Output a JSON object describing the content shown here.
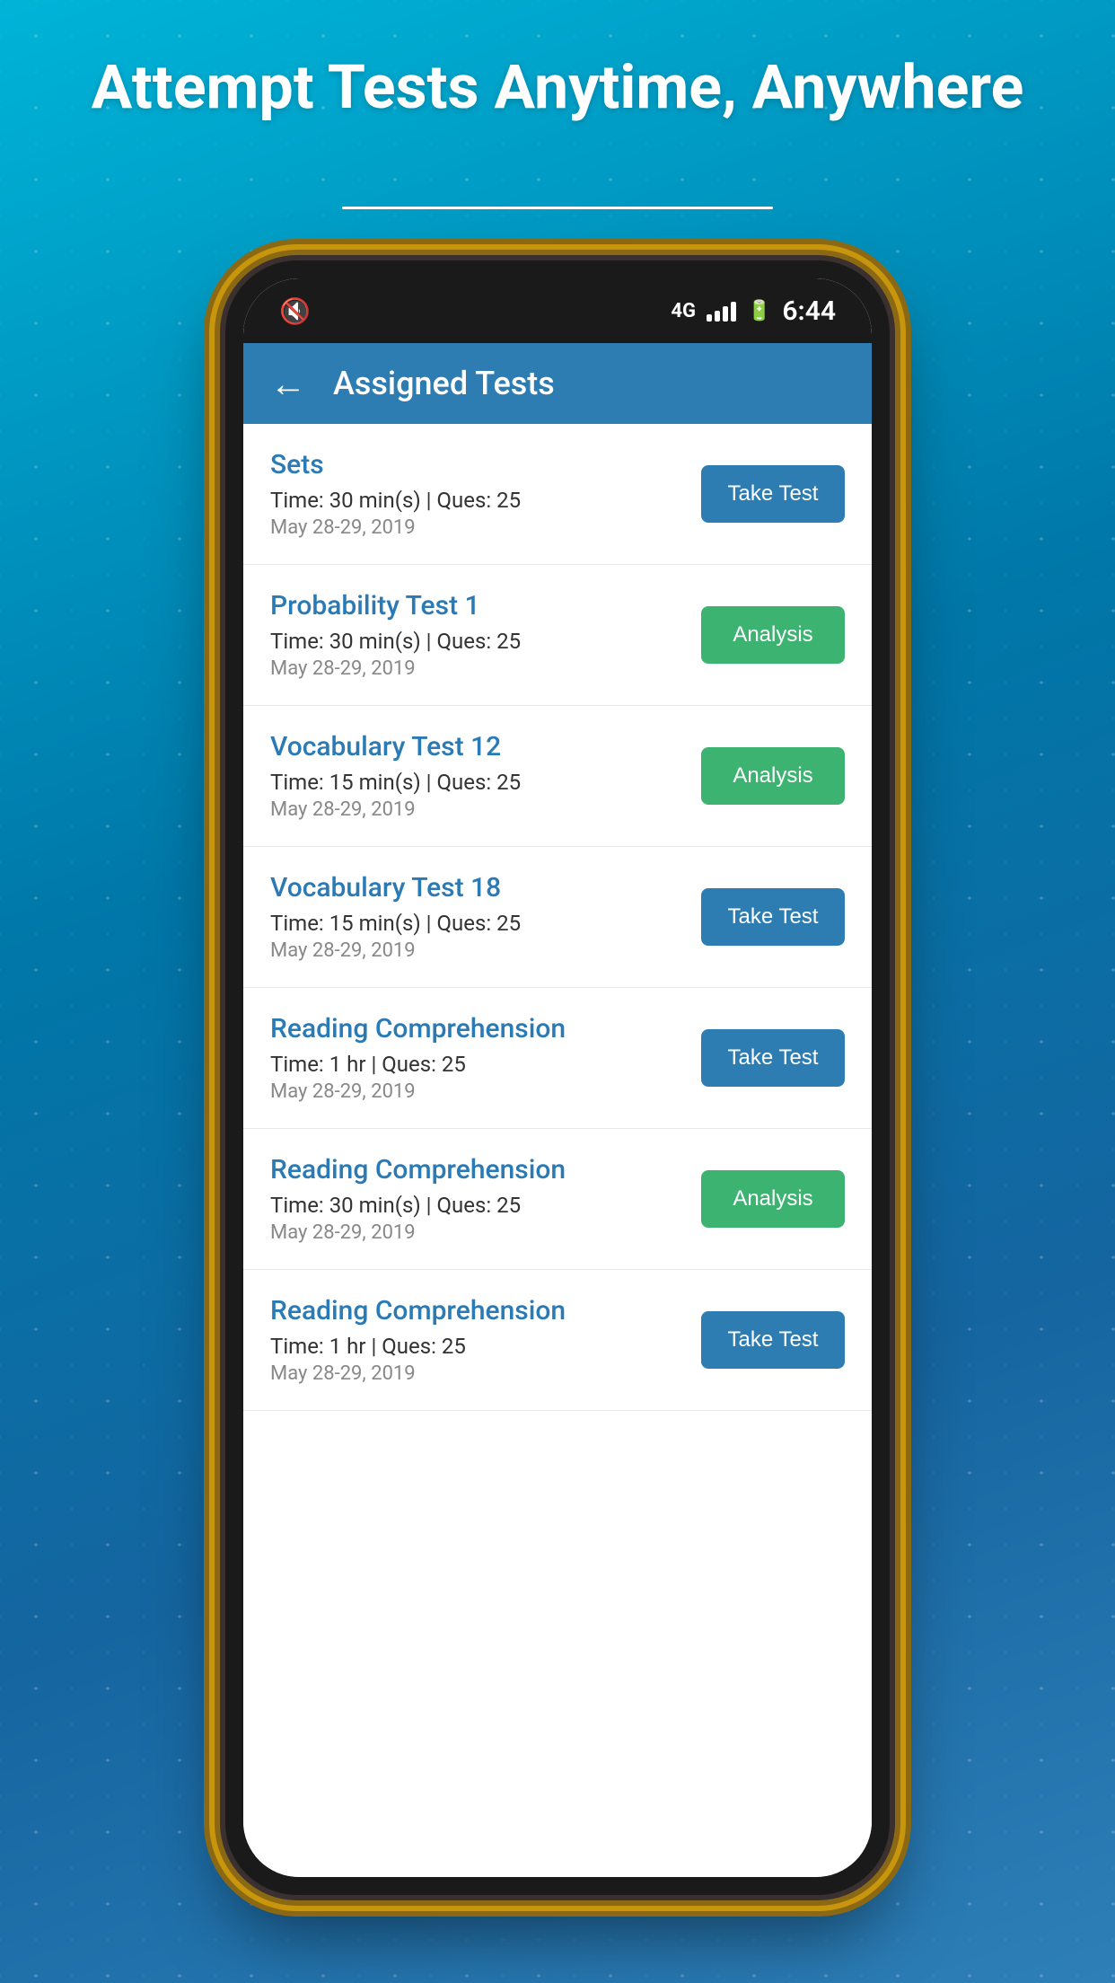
{
  "page": {
    "headline": "Attempt Tests Anytime, Anywhere",
    "status_bar": {
      "time": "6:44",
      "network": "4G"
    },
    "header": {
      "title": "Assigned Tests",
      "back_label": "←"
    },
    "tests": [
      {
        "id": "sets",
        "name": "Sets",
        "time": "Time: 30 min(s) | Ques: 25",
        "date": "May 28-29, 2019",
        "button_type": "take_test",
        "button_label": "Take Test"
      },
      {
        "id": "probability-test-1",
        "name": "Probability Test 1",
        "time": "Time: 30 min(s) | Ques: 25",
        "date": "May 28-29, 2019",
        "button_type": "analysis",
        "button_label": "Analysis"
      },
      {
        "id": "vocabulary-test-12",
        "name": "Vocabulary Test 12",
        "time": "Time: 15 min(s) | Ques: 25",
        "date": "May 28-29, 2019",
        "button_type": "analysis",
        "button_label": "Analysis"
      },
      {
        "id": "vocabulary-test-18",
        "name": "Vocabulary Test 18",
        "time": "Time: 15 min(s) | Ques: 25",
        "date": "May 28-29, 2019",
        "button_type": "take_test",
        "button_label": "Take Test"
      },
      {
        "id": "reading-comprehension-1",
        "name": "Reading Comprehension",
        "time": "Time: 1 hr | Ques: 25",
        "date": "May 28-29, 2019",
        "button_type": "take_test",
        "button_label": "Take Test"
      },
      {
        "id": "reading-comprehension-2",
        "name": "Reading Comprehension",
        "time": "Time: 30 min(s) | Ques: 25",
        "date": "May 28-29, 2019",
        "button_type": "analysis",
        "button_label": "Analysis"
      },
      {
        "id": "reading-comprehension-3",
        "name": "Reading Comprehension",
        "time": "Time: 1 hr | Ques: 25",
        "date": "May 28-29, 2019",
        "button_type": "take_test",
        "button_label": "Take Test"
      }
    ]
  }
}
